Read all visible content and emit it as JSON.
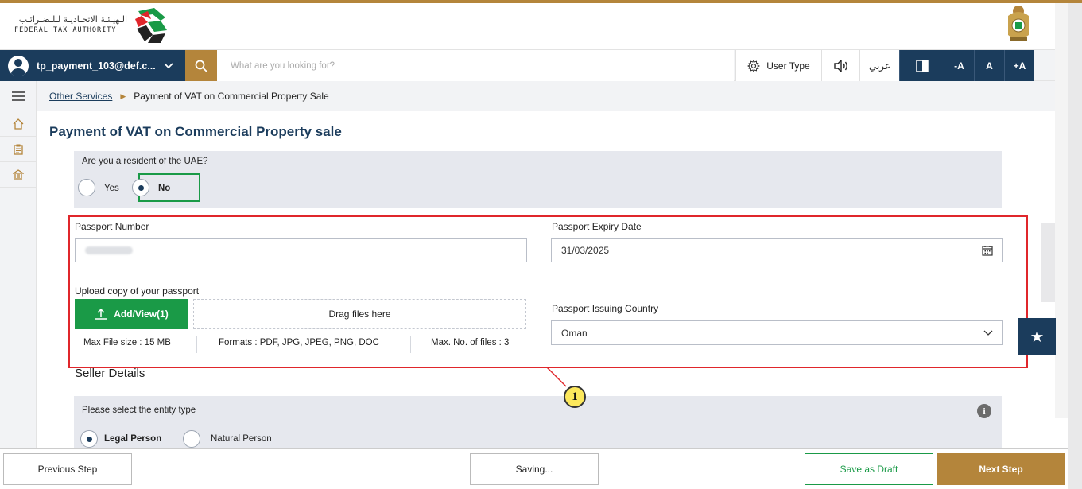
{
  "header": {
    "logo_arabic": "الـهيـئـة الاتحـاديـة لـلـضـرائـب",
    "logo_english": "FEDERAL TAX AUTHORITY"
  },
  "navbar": {
    "user_email": "tp_payment_103@def.c...",
    "search_placeholder": "What are you looking for?",
    "user_type": "User Type",
    "arabic_toggle": "عربي",
    "font_decrease": "-A",
    "font_normal": "A",
    "font_increase": "+A"
  },
  "breadcrumb": {
    "parent": "Other Services",
    "current": "Payment of VAT on Commercial Property Sale"
  },
  "page": {
    "title": "Payment of VAT on Commercial Property sale"
  },
  "resident": {
    "question": "Are you a resident of the UAE?",
    "yes": "Yes",
    "no": "No",
    "selected": "No"
  },
  "passport": {
    "number_label": "Passport Number",
    "expiry_label": "Passport Expiry Date",
    "expiry_value": "31/03/2025",
    "upload_label": "Upload copy of your passport",
    "add_view": "Add/View(1)",
    "drag_here": "Drag files here",
    "max_size": "Max File size : 15 MB",
    "formats": "Formats : PDF, JPG, JPEG, PNG, DOC",
    "max_files": "Max. No. of files : 3",
    "country_label": "Passport Issuing Country",
    "country_value": "Oman"
  },
  "seller": {
    "title": "Seller Details",
    "entity_question": "Please select the entity type",
    "legal_person": "Legal Person",
    "natural_person": "Natural Person",
    "selected": "Legal Person"
  },
  "callout": {
    "number": "1"
  },
  "footer": {
    "previous": "Previous Step",
    "saving": "Saving...",
    "save_draft": "Save as Draft",
    "next": "Next Step"
  },
  "colors": {
    "brand_navy": "#1b3c5c",
    "brand_gold": "#b4853b",
    "success_green": "#1a9a47",
    "highlight_red": "#e0262b"
  }
}
